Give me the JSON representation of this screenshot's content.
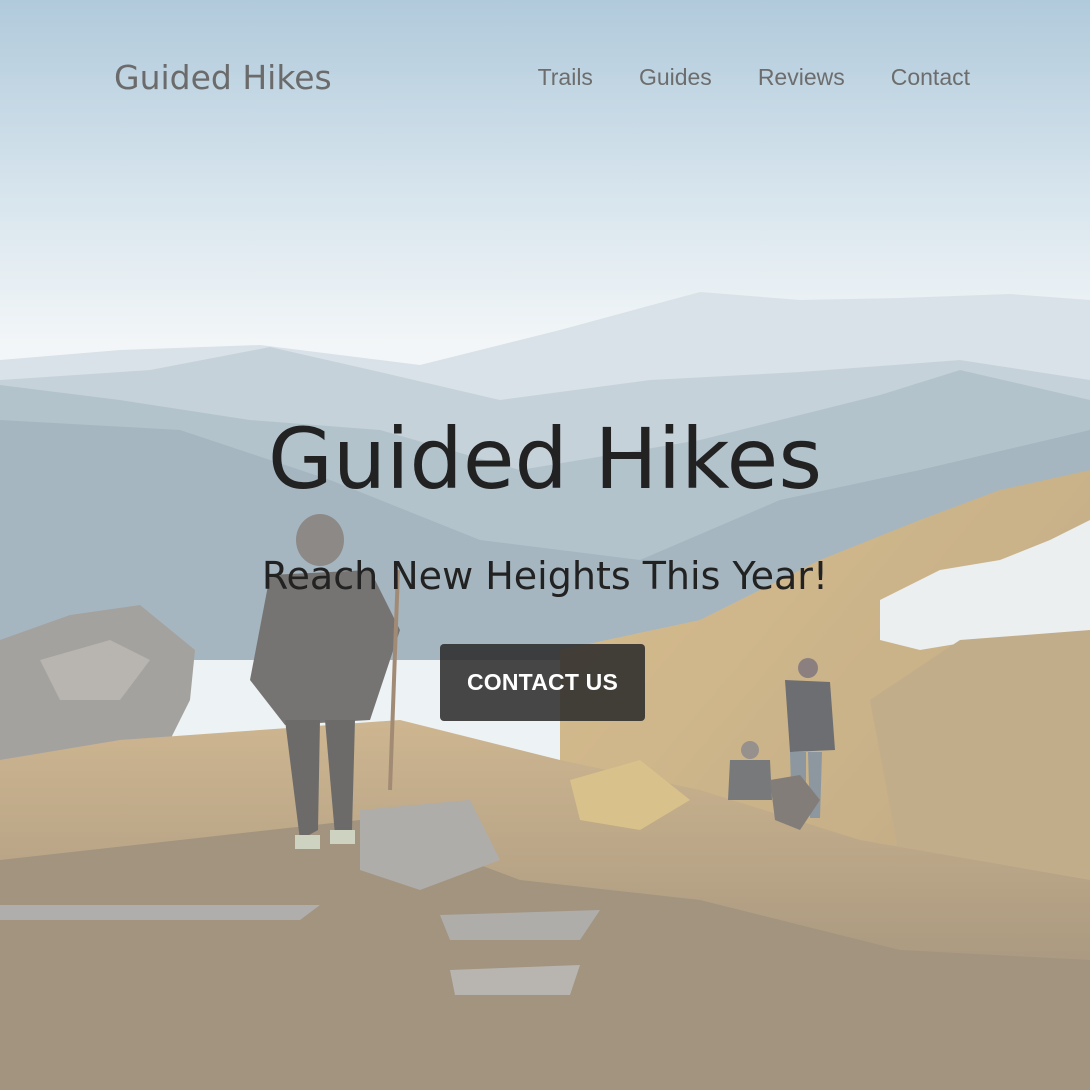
{
  "site": {
    "brand": "Guided Hikes",
    "nav": [
      {
        "label": "Trails"
      },
      {
        "label": "Guides"
      },
      {
        "label": "Reviews"
      },
      {
        "label": "Contact"
      }
    ]
  },
  "hero": {
    "headline": "Guided Hikes",
    "tagline": "Reach New Heights This Year!",
    "cta_label": "CONTACT US"
  },
  "colors": {
    "text_dark": "#222222",
    "nav_text": "#6d6d6d",
    "button_bg": "#282828",
    "button_text": "#ffffff"
  }
}
